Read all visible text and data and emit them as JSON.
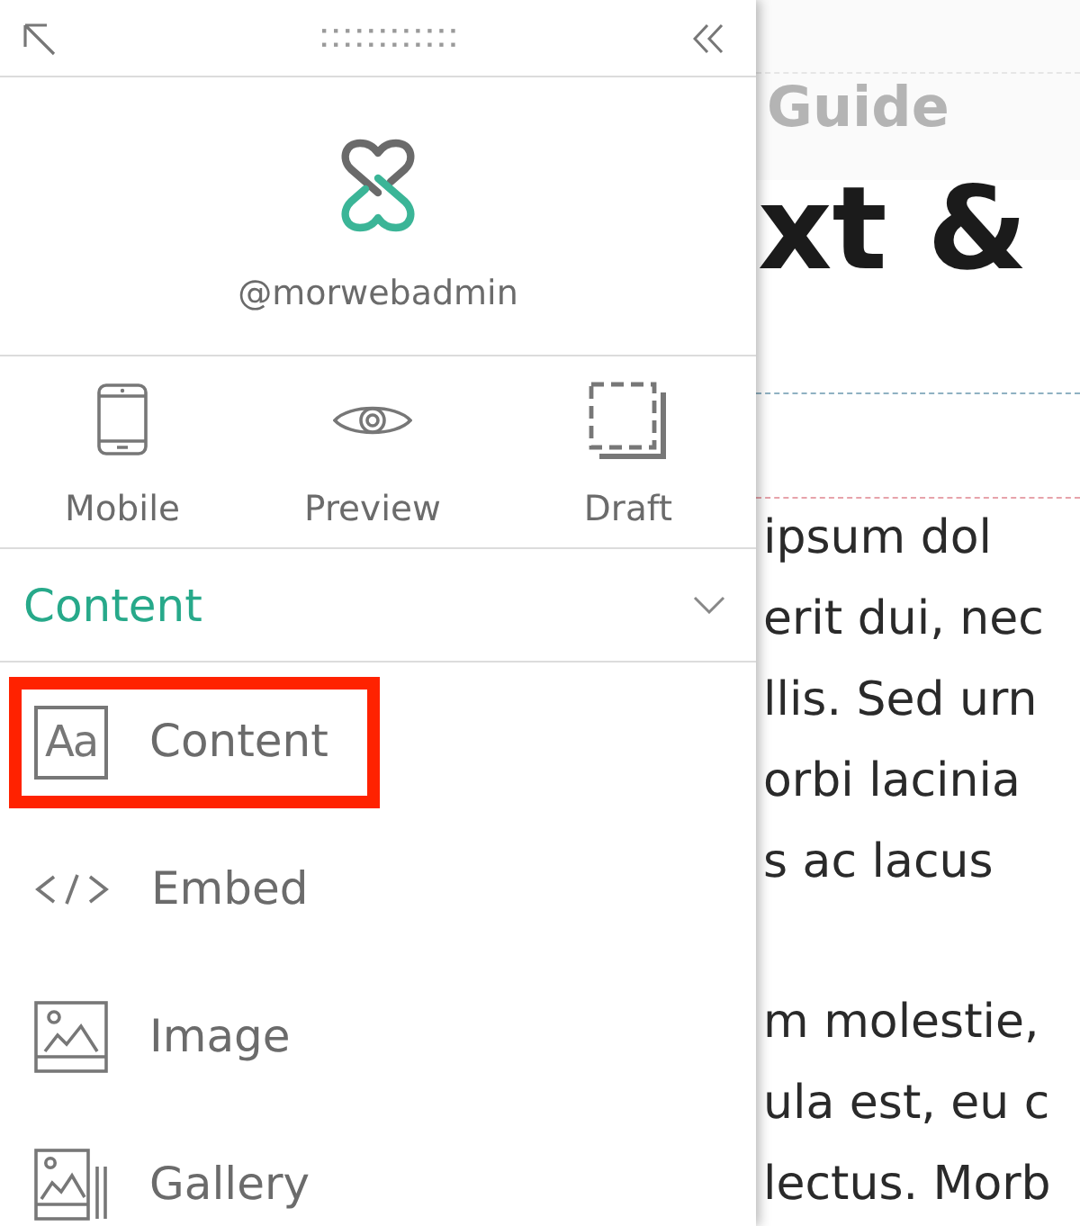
{
  "panel": {
    "username": "@morwebadmin",
    "modes": [
      {
        "kind": "mobile",
        "label": "Mobile"
      },
      {
        "kind": "preview",
        "label": "Preview"
      },
      {
        "kind": "draft",
        "label": "Draft"
      }
    ],
    "section": {
      "title": "Content",
      "expanded": true,
      "items": [
        {
          "kind": "text",
          "icon_text": "Aa",
          "label": "Content",
          "highlighted": true
        },
        {
          "kind": "embed",
          "label": "Embed",
          "highlighted": false
        },
        {
          "kind": "image",
          "label": "Image",
          "highlighted": false
        },
        {
          "kind": "gallery",
          "label": "Gallery",
          "highlighted": false
        }
      ]
    }
  },
  "page": {
    "header_title": "Guide",
    "heading": "xt &",
    "paragraphs": [
      {
        "lines": [
          "ipsum dol",
          "erit dui, nec",
          "llis. Sed urn",
          "orbi lacinia",
          "s ac lacus"
        ]
      },
      {
        "lines": [
          "m molestie,",
          "ula est, eu c",
          "lectus. Morb"
        ]
      }
    ]
  }
}
